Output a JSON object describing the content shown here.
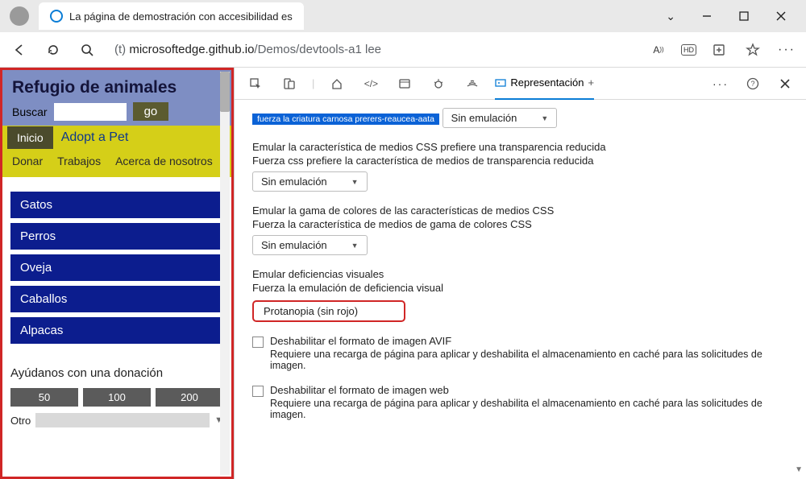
{
  "titlebar": {
    "tab_title": "La página de demostración con accesibilidad es"
  },
  "addrbar": {
    "prefix": "(t) ",
    "host": "microsoftedge.github.io",
    "path": "/Demos/devtools-a1 lee"
  },
  "page": {
    "title": "Refugio de animales",
    "search_label": "Buscar",
    "go": "go",
    "nav": {
      "inicio": "Inicio",
      "adopt": "Adopt a Pet",
      "donar": "Donar",
      "trabajos": "Trabajos",
      "acerca": "Acerca de nosotros"
    },
    "categories": [
      "Gatos",
      "Perros",
      "Oveja",
      "Caballos",
      "Alpacas"
    ],
    "donation": {
      "title": "Ayúdanos con una donación",
      "amounts": [
        "50",
        "100",
        "200"
      ],
      "otro": "Otro"
    }
  },
  "devtools": {
    "tab_label": "Representación",
    "highlight": "fuerza la criatura carnosa prerers-reaucea-aata",
    "no_emulation": "Sin emulación",
    "section1": {
      "t1": "Emular la característica de medios CSS prefiere una transparencia reducida",
      "t2": "Fuerza css prefiere la característica de medios de transparencia reducida"
    },
    "section2": {
      "t1": "Emular la gama de colores de las características de medios CSS",
      "t2": "Fuerza la característica de medios de gama de colores CSS"
    },
    "section3": {
      "t1": "Emular deficiencias visuales",
      "t2": "Fuerza la emulación de deficiencia visual",
      "value": "Protanopia (sin rojo)"
    },
    "check1": {
      "t1": "Deshabilitar el formato de imagen AVIF",
      "t2": "Requiere una recarga de página para aplicar y deshabilita el almacenamiento en caché para las solicitudes de imagen."
    },
    "check2": {
      "t1": "Deshabilitar el formato de imagen web",
      "t2": "Requiere una recarga de página para aplicar y deshabilita el almacenamiento en caché para las solicitudes de imagen."
    }
  }
}
